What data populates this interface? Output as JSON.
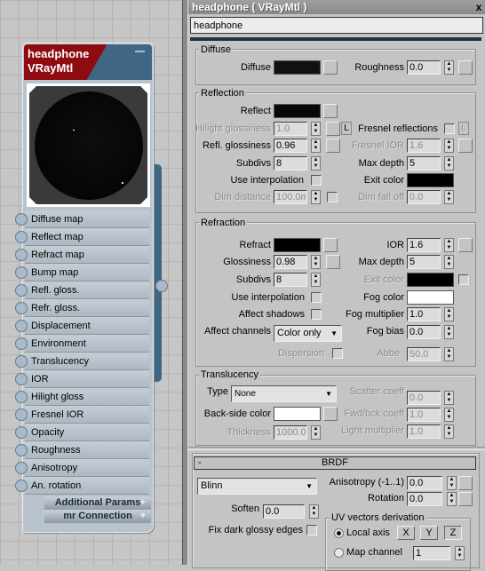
{
  "node": {
    "title": "headphone",
    "subtitle": "VRayMtl",
    "collapse": "—",
    "slots": [
      "Diffuse map",
      "Reflect map",
      "Refract map",
      "Bump map",
      "Refl. gloss.",
      "Refr. gloss.",
      "Displacement",
      "Environment",
      "Translucency",
      "IOR",
      "Hilight gloss",
      "Fresnel IOR",
      "Opacity",
      "Roughness",
      "Anisotropy",
      "An. rotation"
    ],
    "additional": "Additional Params",
    "mr": "mr Connection",
    "plus": "+"
  },
  "editor": {
    "title": "headphone  ( VRayMtl )",
    "close": "x",
    "name_value": "headphone"
  },
  "diffuse": {
    "group": "Diffuse",
    "diffuse_label": "Diffuse",
    "diffuse_color": "#111111",
    "roughness_label": "Roughness",
    "roughness": "0.0"
  },
  "reflection": {
    "group": "Reflection",
    "reflect_label": "Reflect",
    "reflect_color": "#080808",
    "hilight_label": "Hilight glossiness",
    "hilight": "1.0",
    "lock": "L",
    "fresnel_label": "Fresnel reflections",
    "fresnel_lock": "L",
    "refl_gloss_label": "Refl. glossiness",
    "refl_gloss": "0.96",
    "fresnel_ior_label": "Fresnel IOR",
    "fresnel_ior": "1.6",
    "subdivs_label": "Subdivs",
    "subdivs": "8",
    "max_depth_label": "Max depth",
    "max_depth": "5",
    "use_interp_label": "Use interpolation",
    "exit_color_label": "Exit color",
    "exit_color": "#000000",
    "dim_distance_label": "Dim distance",
    "dim_distance": "100.0m",
    "dim_falloff_label": "Dim fall off",
    "dim_falloff": "0.0"
  },
  "refraction": {
    "group": "Refraction",
    "refract_label": "Refract",
    "refract_color": "#000000",
    "ior_label": "IOR",
    "ior": "1.6",
    "glossiness_label": "Glossiness",
    "glossiness": "0.98",
    "max_depth_label": "Max depth",
    "max_depth": "5",
    "subdivs_label": "Subdivs",
    "subdivs": "8",
    "exit_color_label": "Exit color",
    "use_interp_label": "Use interpolation",
    "fog_color_label": "Fog color",
    "fog_color": "#ffffff",
    "affect_shadows_label": "Affect shadows",
    "fog_mult_label": "Fog multiplier",
    "fog_mult": "1.0",
    "affect_channels_label": "Affect channels",
    "affect_channels": "Color only",
    "fog_bias_label": "Fog bias",
    "fog_bias": "0.0",
    "dispersion_label": "Dispersion",
    "abbe_label": "Abbe",
    "abbe": "50.0"
  },
  "translucency": {
    "group": "Translucency",
    "type_label": "Type",
    "type": "None",
    "scatter_label": "Scatter coeff",
    "scatter": "0.0",
    "backside_label": "Back-side color",
    "backside_color": "#ffffff",
    "fwd_label": "Fwd/bck coeff",
    "fwd": "1.0",
    "thickness_label": "Thickness",
    "thickness": "1000.0",
    "light_mult_label": "Light multiplier",
    "light_mult": "1.0"
  },
  "brdf": {
    "rollout": "BRDF",
    "collapse": "-",
    "type": "Blinn",
    "aniso_label": "Anisotropy (-1..1)",
    "aniso": "0.0",
    "rotation_label": "Rotation",
    "rotation": "0.0",
    "soften_label": "Soften",
    "soften": "0.0",
    "fix_dark_label": "Fix dark glossy edges",
    "uv_group": "UV vectors derivation",
    "local_axis_label": "Local axis",
    "axes": [
      "X",
      "Y",
      "Z"
    ],
    "map_channel_label": "Map channel",
    "map_channel": "1",
    "selected_uv": "Local axis"
  }
}
